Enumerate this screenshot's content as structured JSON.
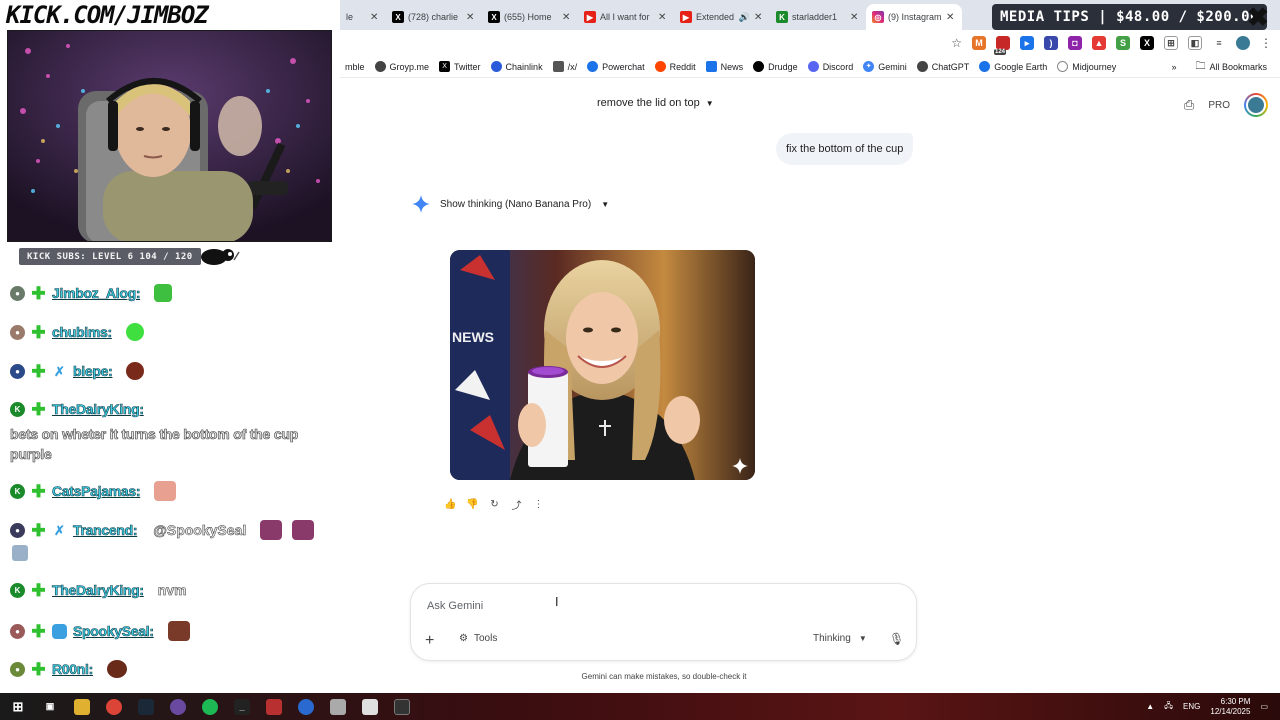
{
  "stream": {
    "banner_text": "KICK.COM/JIMBOZ",
    "subs_text": "KICK SUBS: LEVEL 6 104 / 120",
    "media_tips": "MEDIA TIPS | $48.00 / $200.00"
  },
  "chat": [
    {
      "user": "Jimboz_Alog:",
      "message": "",
      "name_color": "#3fd0e8"
    },
    {
      "user": "chubims:",
      "message": ""
    },
    {
      "user": "biepe:",
      "message": ""
    },
    {
      "user": "TheDairyKing:",
      "message": "bets on wheter it turns the bottom of the cup purple"
    },
    {
      "user": "CatsPajamas:",
      "message": ""
    },
    {
      "user": "Trancend:",
      "message": "@SpookySeal"
    },
    {
      "user": "TheDairyKing:",
      "message": "nvm"
    },
    {
      "user": "SpookySeal:",
      "message": ""
    },
    {
      "user": "R00ni:",
      "message": ""
    }
  ],
  "browser": {
    "tabs": [
      {
        "label": "le",
        "icon": "tab-icon"
      },
      {
        "label": "(728) charlie",
        "icon": "x-icon"
      },
      {
        "label": "(655) Home",
        "icon": "x-icon"
      },
      {
        "label": "All I want for",
        "icon": "youtube-icon"
      },
      {
        "label": "Extended",
        "icon": "youtube-icon"
      },
      {
        "label": "starladder1",
        "icon": "kick-icon"
      },
      {
        "label": "(9) Instagram",
        "icon": "instagram-icon"
      }
    ],
    "bookmarks": [
      {
        "label": "mble"
      },
      {
        "label": "Groyp.me"
      },
      {
        "label": "Twitter"
      },
      {
        "label": "Chainlink"
      },
      {
        "label": "/x/"
      },
      {
        "label": "Powerchat"
      },
      {
        "label": "Reddit"
      },
      {
        "label": "News"
      },
      {
        "label": "Drudge"
      },
      {
        "label": "Discord"
      },
      {
        "label": "Gemini"
      },
      {
        "label": "ChatGPT"
      },
      {
        "label": "Google Earth"
      },
      {
        "label": "Midjourney"
      }
    ],
    "all_bookmarks_label": "All Bookmarks",
    "chevron_label": "»",
    "ext_badge": "124"
  },
  "gemini": {
    "conversation_title": "remove the lid on top",
    "pro_label": "PRO",
    "user_message": "fix the bottom of the cup",
    "thinking_label": "Show thinking (Nano Banana Pro)",
    "image_caption": "NEWS",
    "input_placeholder": "Ask Gemini",
    "tools_label": "Tools",
    "thinking_mode_label": "Thinking",
    "disclaimer": "Gemini can make mistakes, so double-check it"
  },
  "taskbar": {
    "language": "ENG",
    "time": "6:30 PM",
    "date": "12/14/2025"
  },
  "colors": {
    "gemini_blue": "#4285f4",
    "kick_green": "#53fc18",
    "username_cyan": "#3fd0e8"
  }
}
